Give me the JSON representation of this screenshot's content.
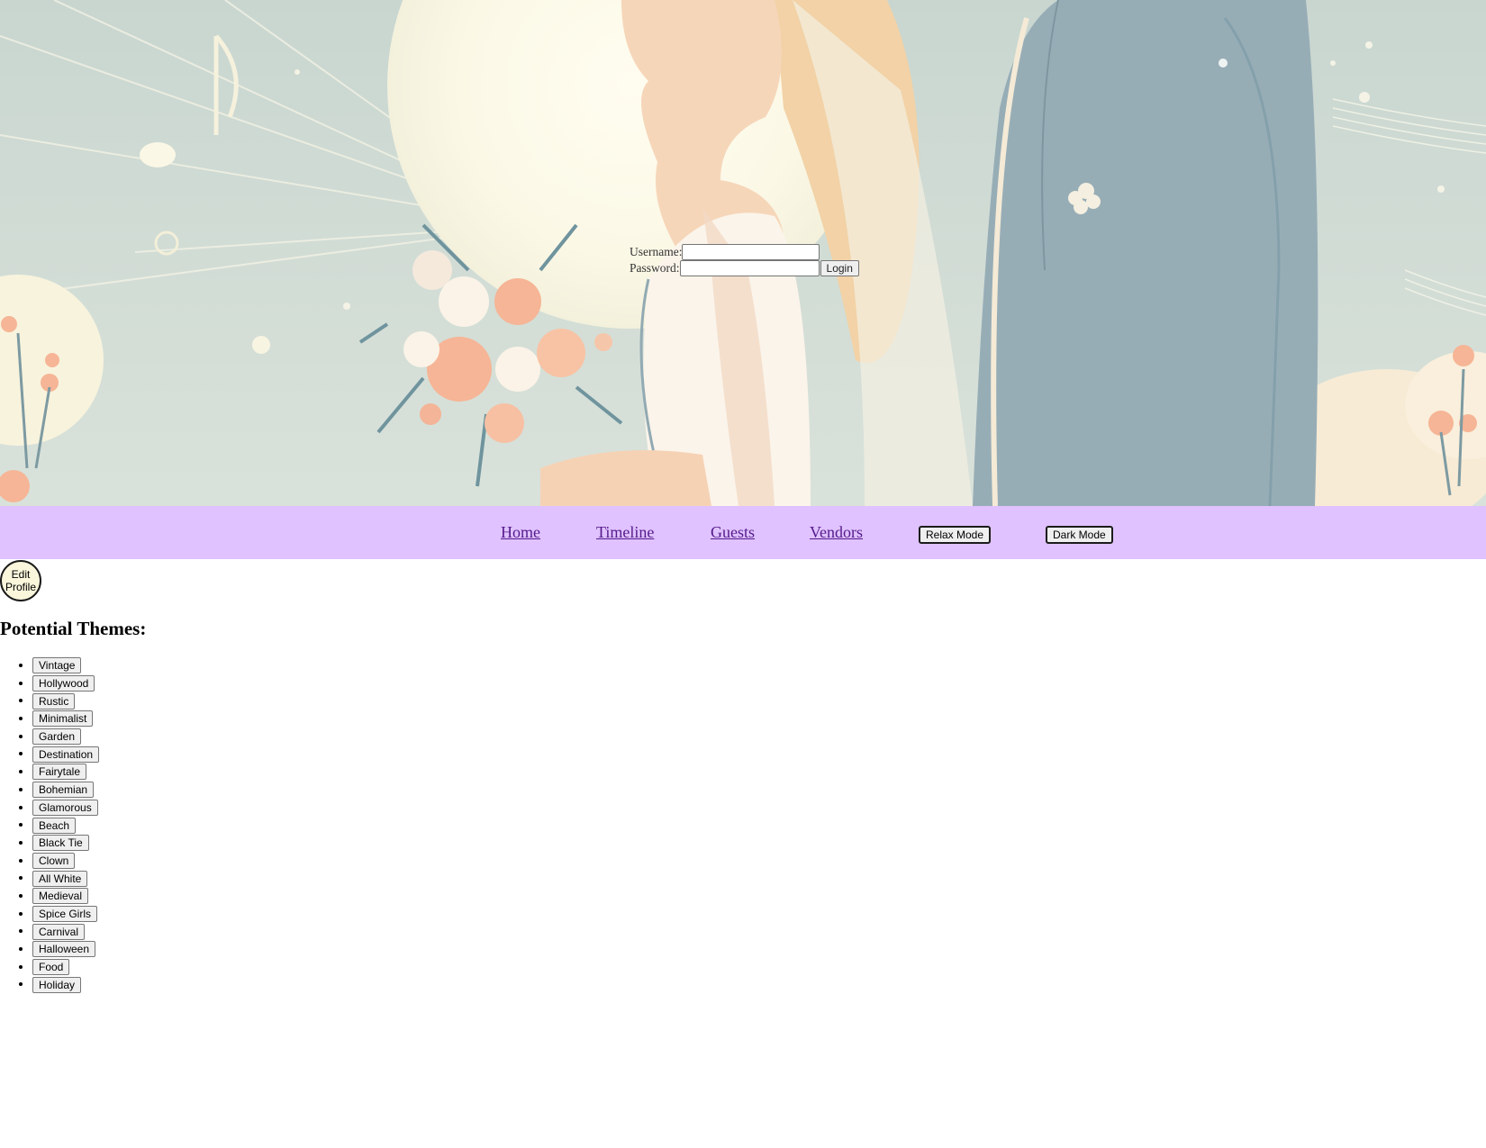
{
  "login": {
    "username_label": "Username:",
    "username_value": "",
    "password_label": "Password:",
    "password_value": "",
    "login_button": "Login"
  },
  "nav": {
    "home": "Home",
    "timeline": "Timeline",
    "guests": "Guests",
    "vendors": "Vendors",
    "relax_mode": "Relax Mode",
    "dark_mode": "Dark Mode"
  },
  "profile": {
    "edit_button": "Edit Profile"
  },
  "themes": {
    "heading": "Potential Themes:",
    "items": [
      "Vintage",
      "Hollywood",
      "Rustic",
      "Minimalist",
      "Garden",
      "Destination",
      "Fairytale",
      "Bohemian",
      "Glamorous",
      "Beach",
      "Black Tie",
      "Clown",
      "All White",
      "Medieval",
      "Spice Girls",
      "Carnival",
      "Halloween",
      "Food",
      "Holiday"
    ]
  },
  "colors": {
    "nav_background": "#dfc2ff",
    "link": "#551a8b",
    "hero_sky": "#cfd9d3",
    "groom_suit": "#97adb6",
    "bride_hair": "#f2d2a6",
    "flowers": "#f6b596"
  }
}
